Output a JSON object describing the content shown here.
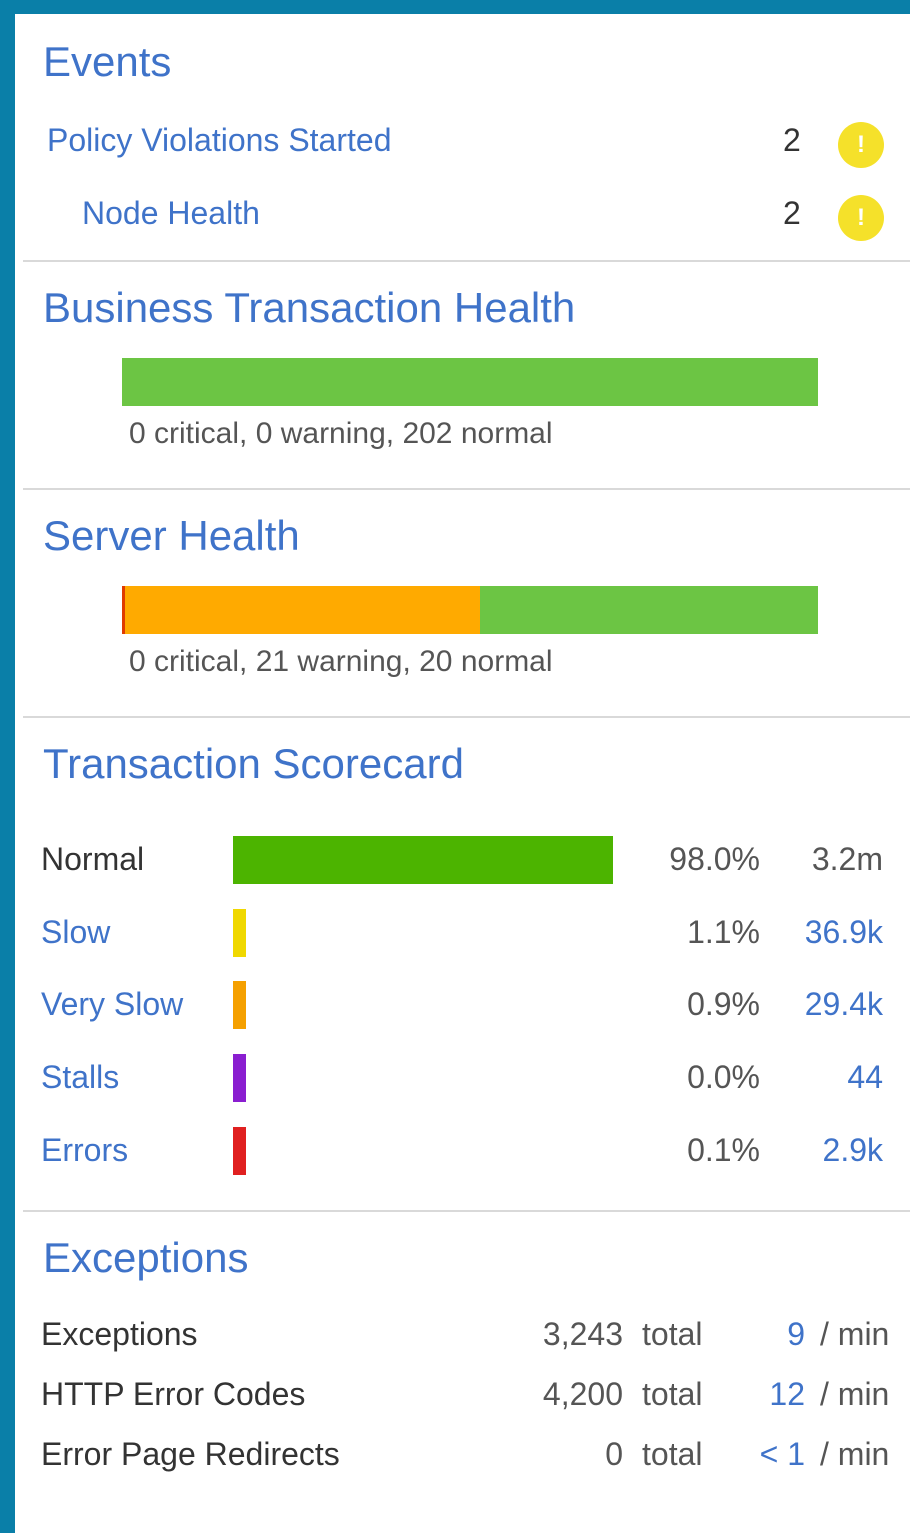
{
  "events": {
    "title": "Events",
    "items": [
      {
        "label": "Policy Violations Started",
        "count": "2",
        "icon": "warning-icon"
      },
      {
        "label": "Node Health",
        "count": "2",
        "icon": "warning-icon"
      }
    ]
  },
  "bt_health": {
    "title": "Business Transaction Health",
    "critical": 0,
    "warning": 0,
    "normal": 202,
    "summary": "0 critical, 0 warning, 202 normal"
  },
  "server_health": {
    "title": "Server Health",
    "critical": 0,
    "warning": 21,
    "normal": 20,
    "summary": "0 critical, 21 warning, 20 normal"
  },
  "scorecard": {
    "title": "Transaction Scorecard",
    "rows": [
      {
        "label": "Normal",
        "percent": "98.0%",
        "count": "3.2m",
        "fraction": 0.98,
        "color": "#4cb400"
      },
      {
        "label": "Slow",
        "percent": "1.1%",
        "count": "36.9k",
        "fraction": 0.011,
        "color": "#f0d800"
      },
      {
        "label": "Very Slow",
        "percent": "0.9%",
        "count": "29.4k",
        "fraction": 0.009,
        "color": "#f5a000"
      },
      {
        "label": "Stalls",
        "percent": "0.0%",
        "count": "44",
        "fraction": 0.0,
        "color": "#8a1ed0"
      },
      {
        "label": "Errors",
        "percent": "0.1%",
        "count": "2.9k",
        "fraction": 0.001,
        "color": "#e02020"
      }
    ]
  },
  "exceptions": {
    "title": "Exceptions",
    "total_word": "total",
    "per_min": "/ min",
    "rows": [
      {
        "label": "Exceptions",
        "total": "3,243",
        "rate": "9"
      },
      {
        "label": "HTTP Error Codes",
        "total": "4,200",
        "rate": "12"
      },
      {
        "label": "Error Page Redirects",
        "total": "0",
        "rate": "< 1"
      }
    ]
  },
  "colors": {
    "critical": "#e03b00",
    "warning": "#ffaa00",
    "normal": "#6cc544",
    "link": "#3f73c9",
    "frame": "#0a7fa8"
  }
}
